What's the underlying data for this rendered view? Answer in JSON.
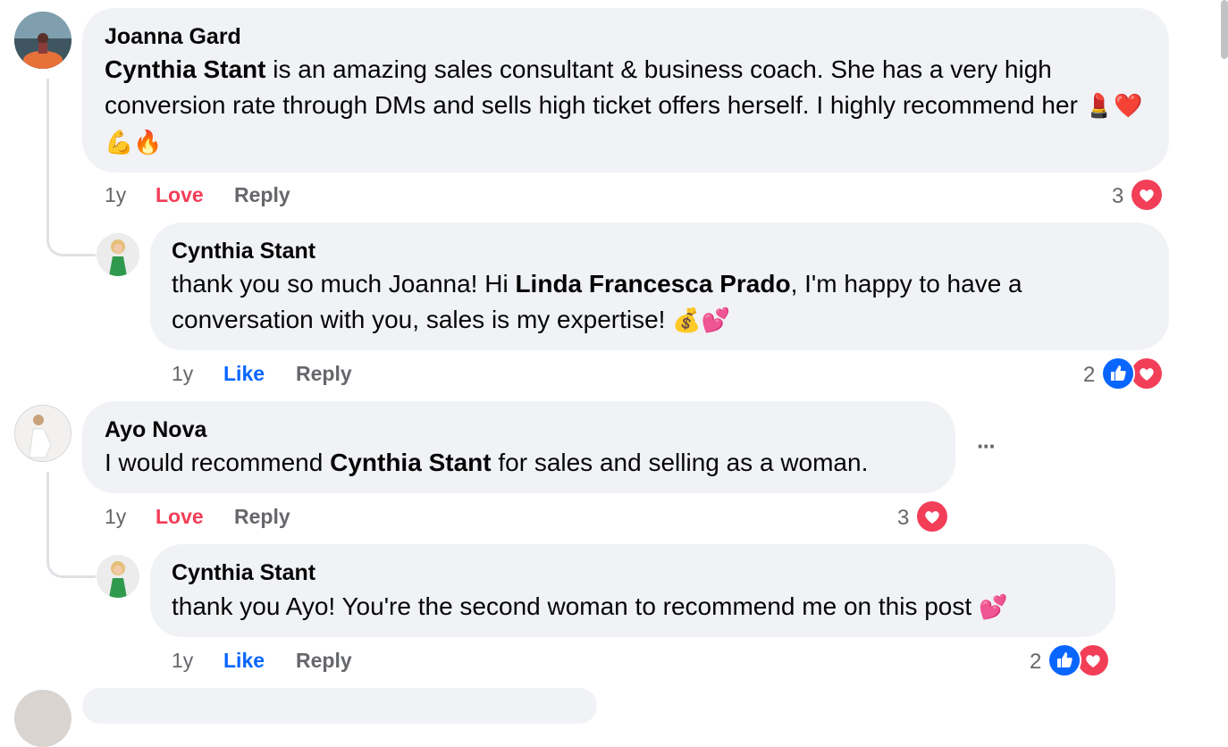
{
  "comments": [
    {
      "author": "Joanna Gard",
      "text_segments": [
        {
          "bold": true,
          "text": "Cynthia Stant"
        },
        {
          "bold": false,
          "text": " is an amazing sales consultant & business coach. She has a very high conversion rate through DMs and sells high ticket offers herself. I highly recommend her "
        }
      ],
      "emojis": [
        "💄",
        "❤️",
        "💪",
        "🔥"
      ],
      "time": "1y",
      "reaction_action": "Love",
      "reply_label": "Reply",
      "reaction_count": "3",
      "reply": {
        "author": "Cynthia Stant",
        "text_segments": [
          {
            "bold": false,
            "text": "thank you so much Joanna! Hi "
          },
          {
            "bold": true,
            "text": "Linda Francesca Prado"
          },
          {
            "bold": false,
            "text": ", I'm happy to have a conversation with you, sales is my expertise! "
          }
        ],
        "emojis": [
          "💰",
          "💕"
        ],
        "time": "1y",
        "reaction_action": "Like",
        "reply_label": "Reply",
        "reaction_count": "2"
      }
    },
    {
      "author": "Ayo Nova",
      "text_segments": [
        {
          "bold": false,
          "text": "I would recommend "
        },
        {
          "bold": true,
          "text": "Cynthia Stant"
        },
        {
          "bold": false,
          "text": " for sales and selling as a woman."
        }
      ],
      "more_label": "···",
      "time": "1y",
      "reaction_action": "Love",
      "reply_label": "Reply",
      "reaction_count": "3",
      "reply": {
        "author": "Cynthia Stant",
        "text_segments": [
          {
            "bold": false,
            "text": "thank you Ayo! You're the second woman to recommend me on this post "
          }
        ],
        "emojis": [
          "💕"
        ],
        "time": "1y",
        "reaction_action": "Like",
        "reply_label": "Reply",
        "reaction_count": "2"
      }
    }
  ],
  "colors": {
    "bubble": "#f0f2f5",
    "love": "#f33e58",
    "like": "#0866ff",
    "meta": "#65676b"
  }
}
